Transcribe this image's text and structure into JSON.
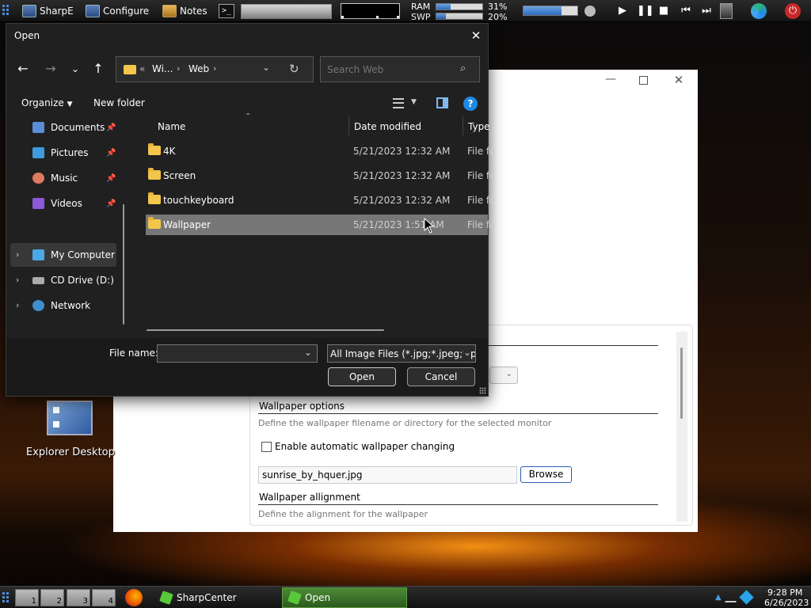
{
  "topbar": {
    "menu_icon": "grid-menu-icon",
    "apps": [
      {
        "label": "SharpE",
        "icon": "computer-icon"
      },
      {
        "label": "Configure",
        "icon": "computer-icon"
      },
      {
        "label": "Notes",
        "icon": "notes-icon"
      }
    ],
    "terminal_icon": "terminal-icon",
    "ram_label": "RAM",
    "swp_label": "SWP",
    "ram_percent": "31%",
    "swp_percent": "20%",
    "ram_fill": 0.31,
    "swp_fill": 0.2,
    "volume_fill": 0.7
  },
  "background_window": {
    "panel": {
      "wallpaper_options_title": "Wallpaper options",
      "wallpaper_options_hint": "Define the wallpaper filename or directory for the selected monitor",
      "auto_change_label": "Enable automatic wallpaper changing",
      "filename_value": "sunrise_by_hquer.jpg",
      "browse_label": "Browse",
      "alignment_title": "Wallpaper allignment",
      "alignment_hint": "Define the alignment for the wallpaper"
    }
  },
  "desktop": {
    "icon_label": "Explorer Desktop"
  },
  "dialog": {
    "title": "Open",
    "breadcrumb": {
      "overflow": "«",
      "part1": "Wi...",
      "part2": "Web"
    },
    "search_placeholder": "Search Web",
    "organize_label": "Organize",
    "new_folder_label": "New folder",
    "sidebar": {
      "quick": [
        {
          "label": "Documents",
          "color": "#5a8fd8"
        },
        {
          "label": "Pictures",
          "color": "#3f9ae0"
        },
        {
          "label": "Music",
          "color": "#e07a5f"
        },
        {
          "label": "Videos",
          "color": "#8c5ad8"
        }
      ],
      "tree": [
        {
          "label": "My Computer",
          "color": "#4aa8e8"
        },
        {
          "label": "CD Drive (D:)",
          "color": "#aaaaaa"
        },
        {
          "label": "Network",
          "color": "#3e8fd0"
        }
      ]
    },
    "columns": {
      "name": "Name",
      "date": "Date modified",
      "type": "Type"
    },
    "files": [
      {
        "name": "4K",
        "date": "5/21/2023 12:32 AM",
        "type": "File fo"
      },
      {
        "name": "Screen",
        "date": "5/21/2023 12:32 AM",
        "type": "File fo"
      },
      {
        "name": "touchkeyboard",
        "date": "5/21/2023 12:32 AM",
        "type": "File fo"
      },
      {
        "name": "Wallpaper",
        "date": "5/21/2023 1:51 AM",
        "type": "File fo"
      }
    ],
    "filename_label": "File name:",
    "filename_value": "",
    "filetype_value": "All Image Files (*.jpg;*.jpeg;*.pr",
    "open_label": "Open",
    "cancel_label": "Cancel"
  },
  "taskbar": {
    "workspaces": [
      "1",
      "2",
      "3",
      "4"
    ],
    "tasks": [
      {
        "label": "SharpCenter",
        "active": false
      },
      {
        "label": "Open",
        "active": true
      }
    ],
    "clock_time": "9:28 PM",
    "clock_date": "6/26/2023"
  }
}
